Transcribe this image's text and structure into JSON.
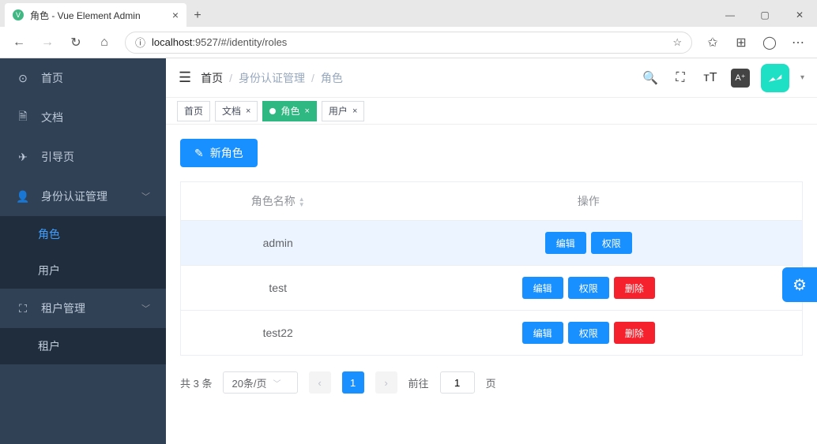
{
  "browser": {
    "tab_title": "角色 - Vue Element Admin",
    "url_host": "localhost",
    "url_port": ":9527",
    "url_path": "/#/identity/roles"
  },
  "sidebar": {
    "items": [
      {
        "icon": "⊙",
        "label": "首页"
      },
      {
        "icon": "🗎",
        "label": "文档"
      },
      {
        "icon": "✈",
        "label": "引导页"
      },
      {
        "icon": "👤",
        "label": "身份认证管理",
        "expandable": true
      },
      {
        "label": "角色",
        "sub": true,
        "active": true
      },
      {
        "label": "用户",
        "sub": true
      },
      {
        "icon": "⛶",
        "label": "租户管理",
        "expandable": true
      },
      {
        "label": "租户",
        "sub": true
      }
    ]
  },
  "breadcrumb": [
    "首页",
    "身份认证管理",
    "角色"
  ],
  "tabs": [
    {
      "label": "首页"
    },
    {
      "label": "文档",
      "closable": true
    },
    {
      "label": "角色",
      "closable": true,
      "active": true
    },
    {
      "label": "用户",
      "closable": true
    }
  ],
  "buttons": {
    "new_role": "新角色",
    "edit": "编辑",
    "perm": "权限",
    "delete": "删除"
  },
  "table": {
    "col_name": "角色名称",
    "col_actions": "操作",
    "rows": [
      {
        "name": "admin",
        "deletable": false,
        "hl": true
      },
      {
        "name": "test",
        "deletable": true
      },
      {
        "name": "test22",
        "deletable": true
      }
    ]
  },
  "pagination": {
    "total_label": "共 3 条",
    "page_size_label": "20条/页",
    "current_page": "1",
    "goto_prefix": "前往",
    "goto_suffix": "页",
    "goto_value": "1"
  }
}
